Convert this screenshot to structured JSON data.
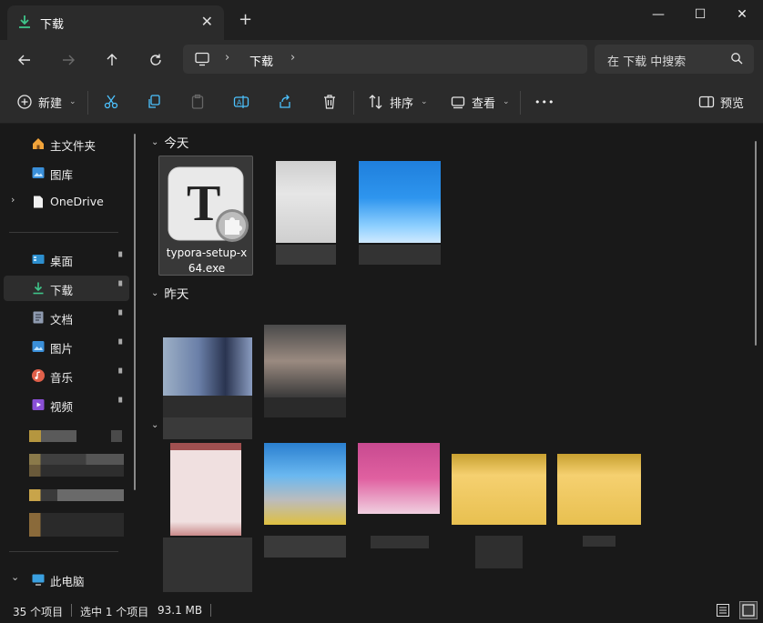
{
  "window": {
    "tab_title": "下载",
    "new_tab": "+",
    "minimize": "—",
    "maximize": "☐",
    "close": "✕",
    "tab_close": "✕"
  },
  "nav": {
    "breadcrumb": "下载",
    "separator": "›",
    "search_placeholder": "在 下载 中搜索"
  },
  "toolbar": {
    "new_label": "新建",
    "sort_label": "排序",
    "view_label": "查看",
    "preview_label": "预览",
    "more_label": "•••"
  },
  "sidebar": {
    "items": [
      {
        "label": "主文件夹"
      },
      {
        "label": "图库"
      },
      {
        "label": "OneDrive",
        "expand": "›"
      },
      {
        "label": "桌面"
      },
      {
        "label": "下载"
      },
      {
        "label": "文档"
      },
      {
        "label": "图片"
      },
      {
        "label": "音乐"
      },
      {
        "label": "视频"
      },
      {
        "label": "此电脑",
        "expand": "⌄"
      }
    ],
    "pin": "📌"
  },
  "content": {
    "group_today": "今天",
    "group_yesterday": "昨天",
    "chevron": "⌄",
    "selected_file_name": "typora-setup-x64.exe"
  },
  "status": {
    "item_count": "35 个项目",
    "selection": "选中 1 个项目",
    "size": "93.1 MB"
  },
  "colors": {
    "accent": "#4cc2ff",
    "download_green": "#3fc58a",
    "background": "#191919",
    "toolbar_bg": "#2b2b2b"
  }
}
